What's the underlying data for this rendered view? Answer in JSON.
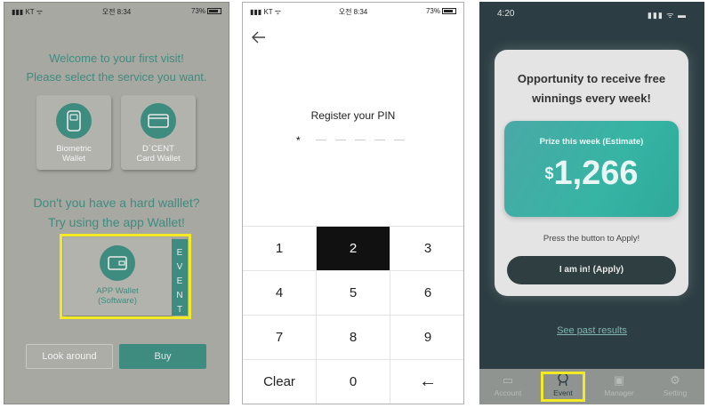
{
  "phone1": {
    "status": {
      "carrier": "KT",
      "time": "오전 8:34",
      "battery": "73%"
    },
    "welcome_line1": "Welcome to your first visit!",
    "welcome_line2": "Please select the service you want.",
    "card_biometric": "Biometric\nWallet",
    "card_dcent": "D`CENT\nCard Wallet",
    "ask_line1": "Don't you have a hard walllet?",
    "ask_line2": "Try using the app Wallet!",
    "app_wallet": "APP Wallet\n(Software)",
    "event_tab": "E\nV\nE\nN\nT",
    "btn_look": "Look around",
    "btn_buy": "Buy",
    "colors": {
      "accent": "#3e8c80",
      "overlay": "#a8a8a2",
      "highlight": "#f3ea23"
    }
  },
  "phone2": {
    "status": {
      "carrier": "KT",
      "time": "오전 8:34",
      "battery": "73%"
    },
    "back_icon": "arrow-left-icon",
    "title": "Register your PIN",
    "pin_entered": "*",
    "pin_length": 6,
    "keys": [
      "1",
      "2",
      "3",
      "4",
      "5",
      "6",
      "7",
      "8",
      "9",
      "Clear",
      "0",
      "←"
    ],
    "active_key": "2"
  },
  "phone3": {
    "time": "4:20",
    "heading_line1": "Opportunity to receive free",
    "heading_line2": "winnings every week!",
    "prize_label": "Prize this week (Estimate)",
    "prize_currency": "$",
    "prize_amount": "1,266",
    "press_text": "Press the button to Apply!",
    "apply_button": "I am in! (Apply)",
    "past_results": "See past results",
    "tabs": [
      "Account",
      "Event",
      "Manager",
      "Setting"
    ],
    "selected_tab": "Event"
  }
}
